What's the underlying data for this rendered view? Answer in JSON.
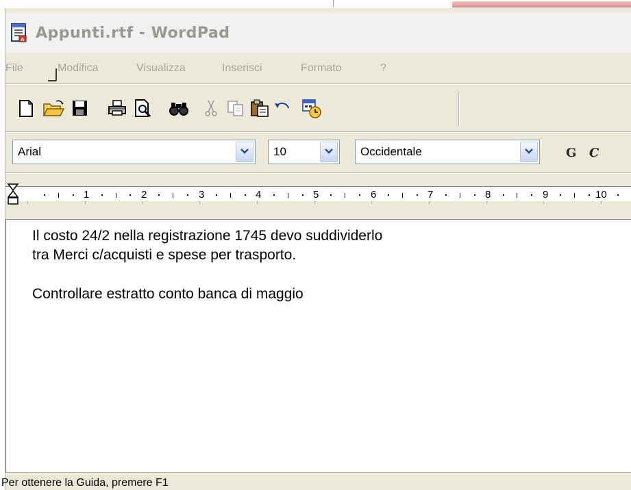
{
  "window": {
    "title": "Appunti.rtf - WordPad"
  },
  "menu": {
    "items": [
      "File",
      "Modifica",
      "Visualizza",
      "Inserisci",
      "Formato",
      "?"
    ]
  },
  "toolbar": {
    "buttons": [
      "new-icon",
      "open-icon",
      "save-icon",
      "print-icon",
      "print-preview-icon",
      "find-icon",
      "cut-icon",
      "copy-icon",
      "paste-icon",
      "undo-icon",
      "date-time-icon"
    ]
  },
  "format": {
    "font": "Arial",
    "size": "10",
    "script": "Occidentale",
    "bold_label": "G",
    "italic_label": "C"
  },
  "ruler": {
    "numbers": [
      "1",
      "2",
      "3",
      "4",
      "5",
      "6",
      "7",
      "8",
      "9",
      "10"
    ]
  },
  "document": {
    "lines": [
      "Il costo 24/2 nella registrazione 1745 devo suddividerlo",
      "tra Merci c/acquisti e spese per trasporto.",
      "",
      "Controllare estratto conto banca di maggio"
    ]
  },
  "status": {
    "text": "Per ottenere la Guida, premere F1"
  },
  "colors": {
    "chrome": "#ece9d8",
    "title_text": "#9a9894",
    "menu_text": "#a9a69f",
    "combo_border": "#7f9db9"
  }
}
